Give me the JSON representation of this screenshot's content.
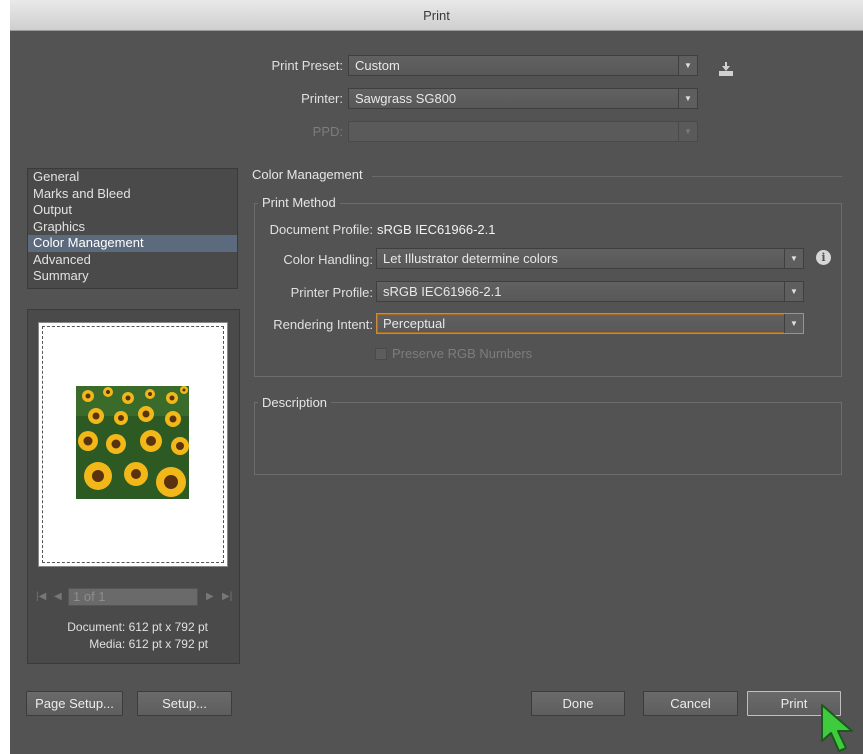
{
  "window": {
    "title": "Print"
  },
  "top": {
    "print_preset": {
      "label": "Print Preset:",
      "value": "Custom"
    },
    "printer": {
      "label": "Printer:",
      "value": "Sawgrass SG800"
    },
    "ppd": {
      "label": "PPD:",
      "value": ""
    }
  },
  "sidebar": {
    "items": [
      {
        "label": "General"
      },
      {
        "label": "Marks and Bleed"
      },
      {
        "label": "Output"
      },
      {
        "label": "Graphics"
      },
      {
        "label": "Color Management",
        "active": true
      },
      {
        "label": "Advanced"
      },
      {
        "label": "Summary"
      }
    ]
  },
  "preview": {
    "pager_text": "1 of 1",
    "document_line": "Document: 612 pt x 792 pt",
    "media_line": "Media: 612 pt x 792 pt"
  },
  "color_management": {
    "section_title": "Color Management",
    "print_method_title": "Print Method",
    "document_profile": {
      "label": "Document Profile:",
      "value": "sRGB IEC61966-2.1"
    },
    "color_handling": {
      "label": "Color Handling:",
      "value": "Let Illustrator determine colors"
    },
    "printer_profile": {
      "label": "Printer Profile:",
      "value": "sRGB IEC61966-2.1"
    },
    "rendering_intent": {
      "label": "Rendering Intent:",
      "value": "Perceptual"
    },
    "preserve_rgb": {
      "label": "Preserve RGB Numbers",
      "checked": false
    }
  },
  "description": {
    "title": "Description",
    "text": ""
  },
  "buttons": {
    "page_setup": "Page Setup...",
    "setup": "Setup...",
    "done": "Done",
    "cancel": "Cancel",
    "print": "Print"
  },
  "colors": {
    "dialog_bg": "#535353",
    "active_item": "#5c6a7e",
    "focus_border": "#c98a3a",
    "cursor": "#3ecb3e"
  }
}
